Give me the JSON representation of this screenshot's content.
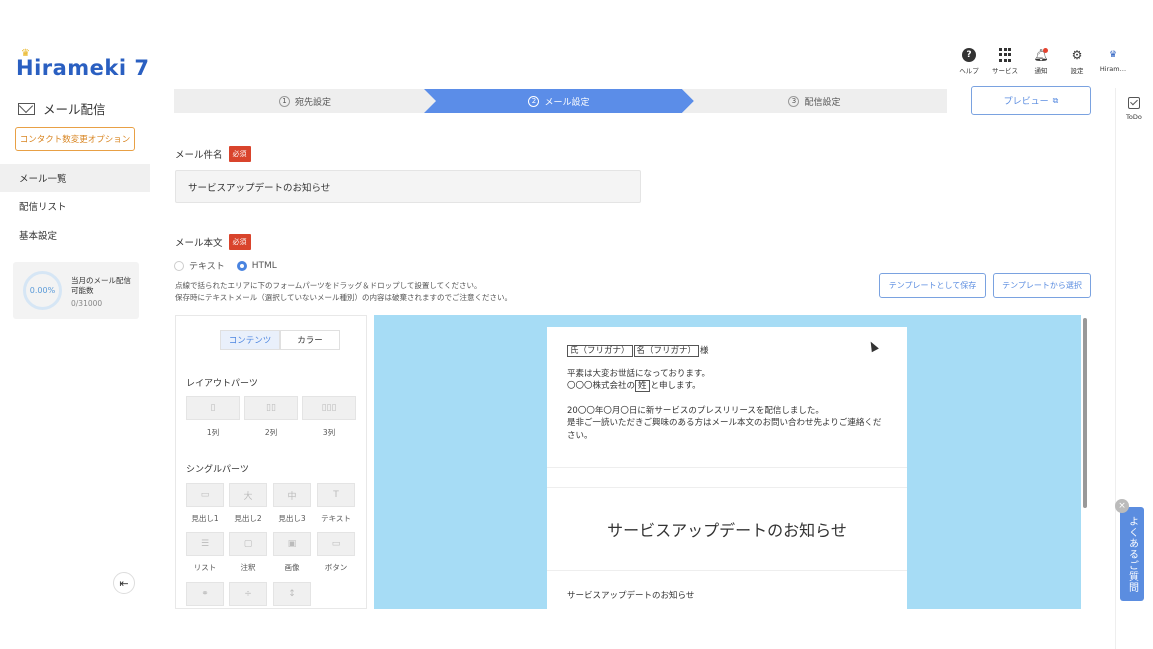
{
  "app": {
    "logo": "Hirameki 7"
  },
  "sidebar": {
    "section_title": "メール配信",
    "option_button": "コンタクト数変更オプション",
    "nav": [
      {
        "label": "メール一覧",
        "active": true
      },
      {
        "label": "配信リスト",
        "active": false
      },
      {
        "label": "基本設定",
        "active": false
      }
    ],
    "quota": {
      "percent": "0.00%",
      "label": "当月のメール配信可能数",
      "count": "0/31000"
    }
  },
  "topbar": {
    "items": [
      {
        "label": "ヘルプ",
        "icon": "help-icon"
      },
      {
        "label": "サービス",
        "icon": "grid-icon"
      },
      {
        "label": "通知",
        "icon": "bell-icon"
      },
      {
        "label": "設定",
        "icon": "gear-icon"
      },
      {
        "label": "Hiram…",
        "icon": "avatar-icon"
      }
    ],
    "todo": "ToDo"
  },
  "stepper": {
    "steps": [
      {
        "num": "1",
        "label": "宛先設定",
        "state": "done"
      },
      {
        "num": "2",
        "label": "メール設定",
        "state": "current"
      },
      {
        "num": "3",
        "label": "配信設定",
        "state": "next"
      }
    ],
    "preview": "プレビュー"
  },
  "form": {
    "subject_label": "メール件名",
    "required": "必須",
    "subject_value": "サービスアップデートのお知らせ",
    "body_label": "メール本文",
    "formats": [
      {
        "label": "テキスト",
        "selected": false
      },
      {
        "label": "HTML",
        "selected": true
      }
    ],
    "note1": "点線で括られたエリアに下のフォームパーツをドラッグ＆ドロップして設置してください。",
    "note2": "保存時にテキストメール（選択していないメール種別）の内容は破棄されますのでご注意ください。",
    "save_template": "テンプレートとして保存",
    "select_template": "テンプレートから選択"
  },
  "parts_panel": {
    "tabs": [
      "コンテンツ",
      "カラー"
    ],
    "layout_title": "レイアウトパーツ",
    "layout_parts": [
      "1列",
      "2列",
      "3列"
    ],
    "single_title": "シングルパーツ",
    "single_parts": [
      "見出し1",
      "見出し2",
      "見出し3",
      "テキスト",
      "リスト",
      "注釈",
      "画像",
      "ボタン"
    ]
  },
  "editor": {
    "tag_last": "氏（フリガナ）",
    "tag_first": "名（フリガナ）",
    "honorific": "様",
    "line1": "平素は大変お世話になっております。",
    "line2_pre": "〇〇〇株式会社の",
    "line2_tag": "姓",
    "line2_post": "と申します。",
    "line3": "20〇〇年〇月〇日に新サービスのプレスリリースを配信しました。",
    "line4": "是非ご一読いただきご興味のある方はメール本文のお問い合わせ先よりご連絡ください。",
    "heading": "サービスアップデートのお知らせ",
    "body2": "サービスアップデートのお知らせ"
  },
  "faq": "よくあるご質問"
}
